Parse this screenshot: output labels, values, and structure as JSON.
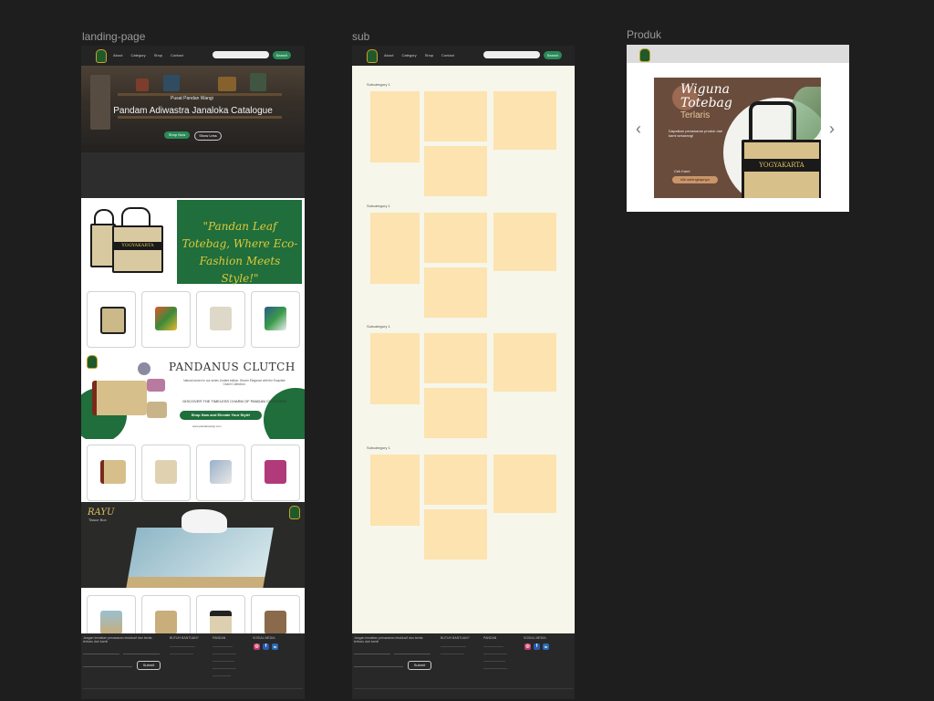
{
  "frames": {
    "landing": {
      "label": "landing-page",
      "nav": {
        "links": [
          "About",
          "Category",
          "Shop",
          "Contact"
        ],
        "button": "Search"
      },
      "hero": {
        "subtitle": "Pusat Pandan Wangi",
        "title": "Pandam Adiwastra Janaloka Catalogue",
        "btn_primary": "Shop Now",
        "btn_secondary": "Show Less"
      },
      "promo": {
        "text": "\"Pandan Leaf Totebag, Where Eco-Fashion Meets Style!\"",
        "bag_label": "YOGYAKARTA"
      },
      "clutch": {
        "title": "PANDANUS CLUTCH",
        "small_text": "Natural woven in our series Limited edition. Woven Elegance with the Exquisite Clutch Collection.",
        "discover": "DISCOVER THE TIMELESS CHARM OF PANDAN CLUTCHES",
        "button": "Shop Now and Elevate Your Style!",
        "url": "www.pandanwangi.com"
      },
      "rayu": {
        "title": "RAYU",
        "subtitle": "Tissue Box"
      }
    },
    "sub": {
      "label": "sub",
      "nav": {
        "links": [
          "About",
          "Category",
          "Shop",
          "Contact"
        ],
        "button": "Search"
      },
      "subcategories": [
        "Subcategory 1",
        "Subcategory 1",
        "Subcategory 1",
        "Subcategory 1"
      ]
    },
    "produk": {
      "label": "Produk",
      "banner": {
        "title1": "Wiguna",
        "title2": "Totebag",
        "title3": "Terlaris",
        "desc": "Dapatkan penawaran produk dari kami sekarang!",
        "cta_label": "Cek Kami",
        "cta_button": "klik selengkapnya",
        "bag_label": "YOGYAKARTA"
      }
    }
  },
  "footer": {
    "headline": "Jangan lewatkan penawaran eksklusif dan berita terbaru dari kami!",
    "col2_title": "BUTUH BANTUAN?",
    "col3_title": "PANDAN",
    "col4_title": "SOSIAL MEDIA",
    "submit": "Submit",
    "social": [
      "instagram-icon",
      "facebook-icon",
      "linkedin-icon"
    ]
  }
}
